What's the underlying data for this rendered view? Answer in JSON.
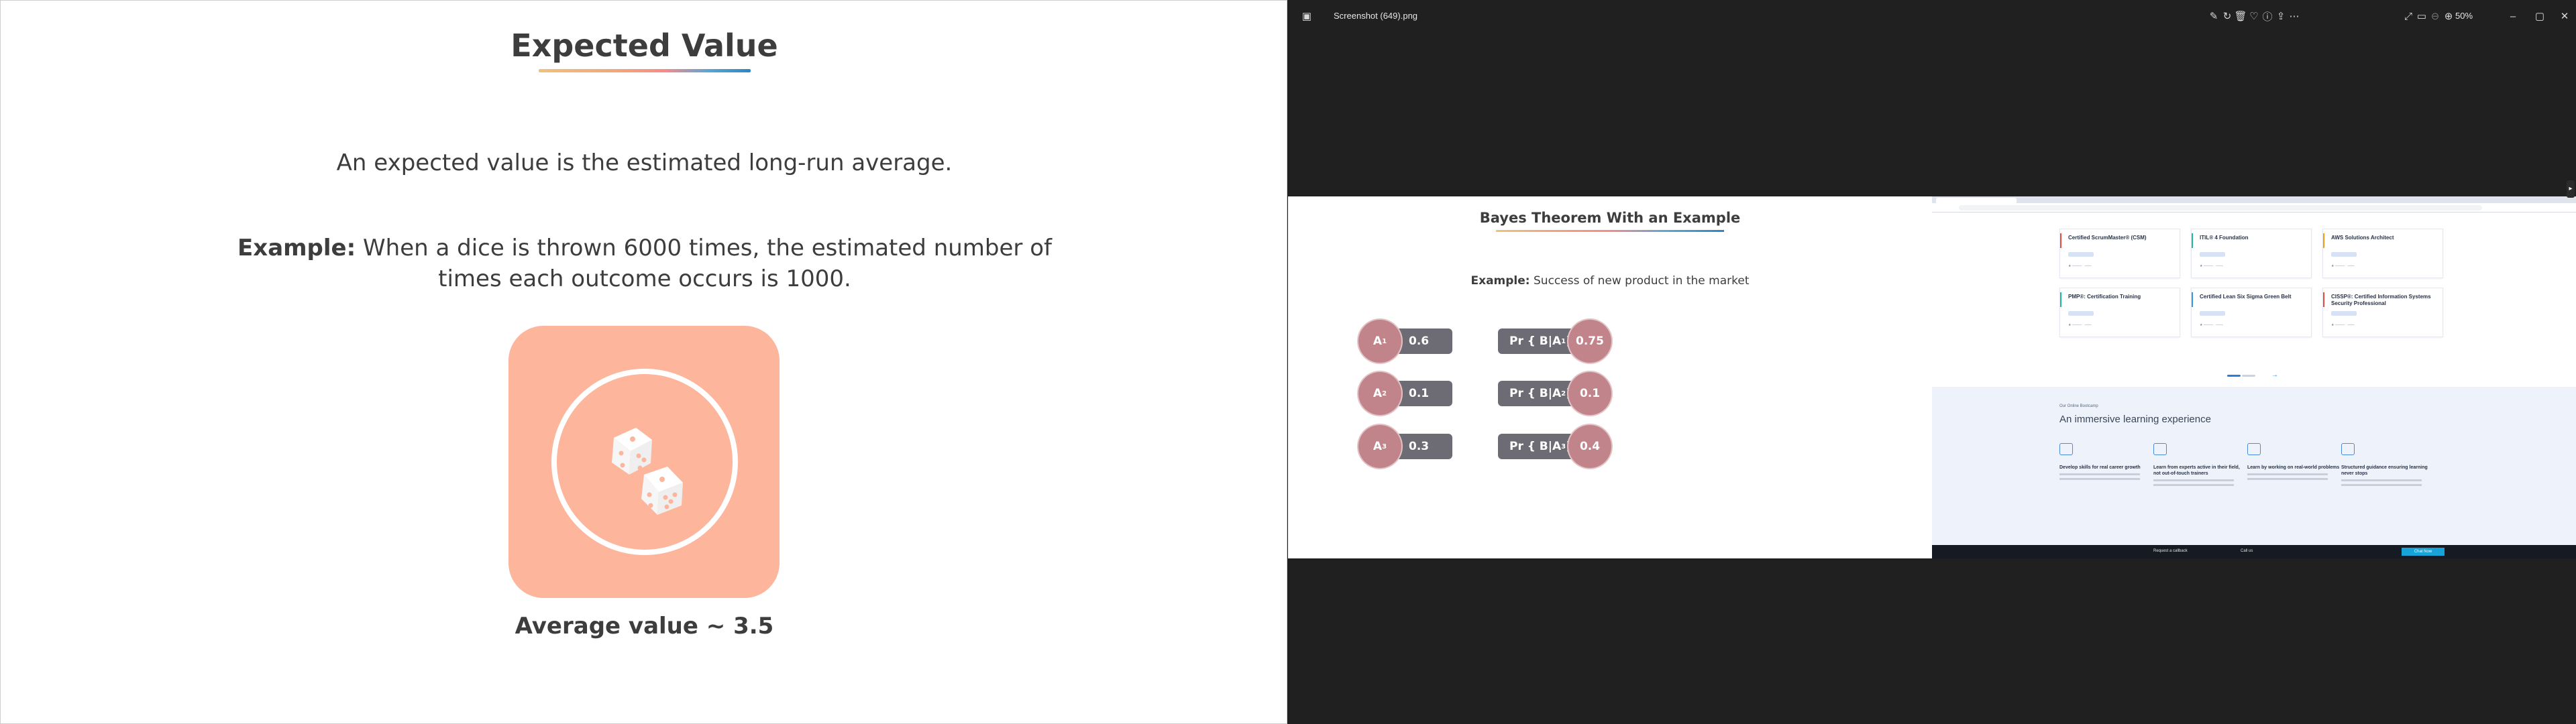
{
  "left_slide": {
    "title": "Expected Value",
    "lead": "An expected value is the estimated long-run average.",
    "example_label": "Example:",
    "example_text": " When a dice is thrown 6000 times, the estimated number of times each outcome occurs is 1000.",
    "dice_icon": "dice-icon",
    "average": "Average value ~ 3.5",
    "tile_color": "#fdb59c"
  },
  "viewer": {
    "filename": "Screenshot (649).png",
    "zoom": "50%",
    "toolbar_icons": [
      "edit-icon",
      "rotate-icon",
      "delete-icon",
      "favorite-icon",
      "info-icon",
      "share-icon",
      "more-icon"
    ],
    "right_icons": [
      "fullscreen-icon",
      "fit-icon",
      "zoom-out-icon",
      "zoom-in-icon"
    ],
    "window_controls": [
      "minimize-icon",
      "maximize-icon",
      "close-icon"
    ]
  },
  "bayes": {
    "title": "Bayes Theorem With an Example",
    "example_label": "Example:",
    "example_text": " Success of new product in the market",
    "priors": [
      {
        "label": "A",
        "sub": "1",
        "value": "0.6"
      },
      {
        "label": "A",
        "sub": "2",
        "value": "0.1"
      },
      {
        "label": "A",
        "sub": "3",
        "value": "0.3"
      }
    ],
    "likelihoods": [
      {
        "label": "Pr { B|A",
        "sub": "1",
        "close": " }",
        "value": "0.75"
      },
      {
        "label": "Pr { B|A",
        "sub": "2",
        "close": " }",
        "value": "0.1"
      },
      {
        "label": "Pr { B|A",
        "sub": "3",
        "close": " }",
        "value": "0.4"
      }
    ]
  },
  "browser": {
    "cards": [
      {
        "title": "Certified ScrumMaster® (CSM)",
        "accent": "#e74c3c"
      },
      {
        "title": "ITIL® 4 Foundation",
        "accent": "#1abc9c"
      },
      {
        "title": "AWS Solutions Architect",
        "accent": "#f39c12"
      },
      {
        "title": "PMP®: Certification Training",
        "accent": "#1abc9c"
      },
      {
        "title": "Certified Lean Six Sigma Green Belt",
        "accent": "#3498db"
      },
      {
        "title": "CISSP®: Certified Information Systems Security Professional",
        "accent": "#e74c3c"
      }
    ],
    "learn_kicker": "Our Online Bootcamp",
    "learn_heading": "An immersive learning experience",
    "features": [
      "Develop skills for real career growth",
      "Learn from experts active in their field, not out-of-touch trainers",
      "Learn by working on real-world problems",
      "Structured guidance ensuring learning never stops"
    ],
    "footer_request": "Request a callback",
    "footer_call": "Call us",
    "footer_cta": "Chat Now"
  }
}
